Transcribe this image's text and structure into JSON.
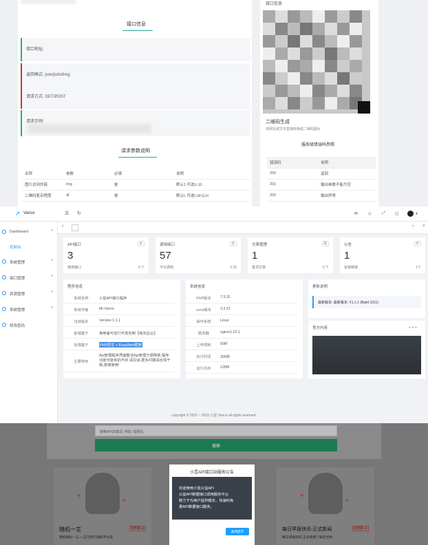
{
  "top": {
    "section_api_info": "接口信息",
    "rows": [
      {
        "label": "接口地址:"
      },
      {
        "label": "返回格式: json/js/txt/img"
      },
      {
        "label": "请求方式: GET/POST"
      },
      {
        "label": "请求示例:"
      }
    ],
    "section_params": "请求参数说明",
    "param_headers": [
      "名称",
      "参数",
      "必填",
      "说明"
    ],
    "params": [
      [
        "图片达到外链",
        "img",
        "是",
        "默认1 可选1-10"
      ],
      [
        "二维码复杂程度",
        "dt",
        "是",
        "默认L 可选L,M,Q,H"
      ]
    ],
    "right_header": "接口信息",
    "qr_title": "二维码生成",
    "qr_desc": "将网址或文字直接转换成二维码图片",
    "err_title": "服务级错误码参照",
    "err_headers": [
      "错误码",
      "说明"
    ],
    "errors": [
      [
        "200",
        "返回"
      ],
      [
        "201",
        "输出参数不能为空"
      ],
      [
        "202",
        "输出异常"
      ]
    ]
  },
  "admin": {
    "brand": "Vance",
    "menu": [
      {
        "label": "Dashboard",
        "sub": "控制台"
      },
      {
        "label": "系统管理"
      },
      {
        "label": "接口管理"
      },
      {
        "label": "资源管理"
      },
      {
        "label": "系统管理"
      },
      {
        "label": "修改密码"
      }
    ],
    "stats": [
      {
        "title": "API接口",
        "badge": "总",
        "value": "3",
        "sub": "使用接口",
        "subr": "0 个"
      },
      {
        "title": "调用接口",
        "badge": "总",
        "value": "57",
        "sub": "今日调用",
        "subr": "0 次"
      },
      {
        "title": "文章管理",
        "badge": "篇",
        "value": "1",
        "sub": "置顶文章",
        "subr": "0 个"
      },
      {
        "title": "公告",
        "badge": "条",
        "value": "1",
        "sub": "友链链接",
        "subr": "1个"
      }
    ],
    "program_info_title": "程序信息",
    "program_info": [
      {
        "k": "系统名称",
        "v": "小昱API接口程序"
      },
      {
        "k": "系统作者",
        "v": "Mr.Vance"
      },
      {
        "k": "当前版本",
        "v": "Version 1.1.1"
      },
      {
        "k": "前端基于",
        "v": "使用者可自行开发定制【纯无后台】"
      },
      {
        "k": "后端基于",
        "v": "PHP原生 + EasyWeb框架"
      },
      {
        "k": "主要特色",
        "v": "Api管理程序界面整洁Api管理方便简单,程序功能可能有的不好,请见谅,更多问题请反馈于我,感谢使用!"
      }
    ],
    "system_info_title": "系统信息",
    "system_info": [
      {
        "k": "PHP版本",
        "v": "7.3.31"
      },
      {
        "k": "zend版本",
        "v": "3.3.31"
      },
      {
        "k": "操作系统",
        "v": "Linux"
      },
      {
        "k": "服务器",
        "v": "nginx/1.22.1"
      },
      {
        "k": "上传限制",
        "v": "50M"
      },
      {
        "k": "执行时间",
        "v": "300秒"
      },
      {
        "k": "运行内存",
        "v": "128M"
      }
    ],
    "update_title": "更新说明",
    "update_text": "最新版本: 最新版本: V1.1.1 (Build 1011)",
    "official_title": "官方内容",
    "footer": "copyright © 2021 ~ 2023 小昱 Vance all rights reserved."
  },
  "bottom": {
    "search_placeholder": "搜索API关键词, 例如: 短网址",
    "search_button": "搜索",
    "modal_title": "小昱API接口站服务公告",
    "modal_lines": [
      "欢迎使用小昱公益API",
      "公益API数据接口调用服务平台",
      "致力于为用户提供稳定、快速的免",
      "费API数据接口服务。"
    ],
    "modal_button": "关闭提示",
    "card_left_title": "随机一言",
    "card_left_badge": "调用量 26",
    "card_left_desc": "随机输出一言,一言可用于随机评论等",
    "card_right_title": "每日早报快讯-正式新闻",
    "card_right_badge": "调用量 26",
    "card_right_desc": "每日早报快讯,正式新闻了解全世界"
  },
  "colors": {
    "accent": "#1e9fff",
    "green": "#20a36a",
    "dark": "#39404a"
  }
}
